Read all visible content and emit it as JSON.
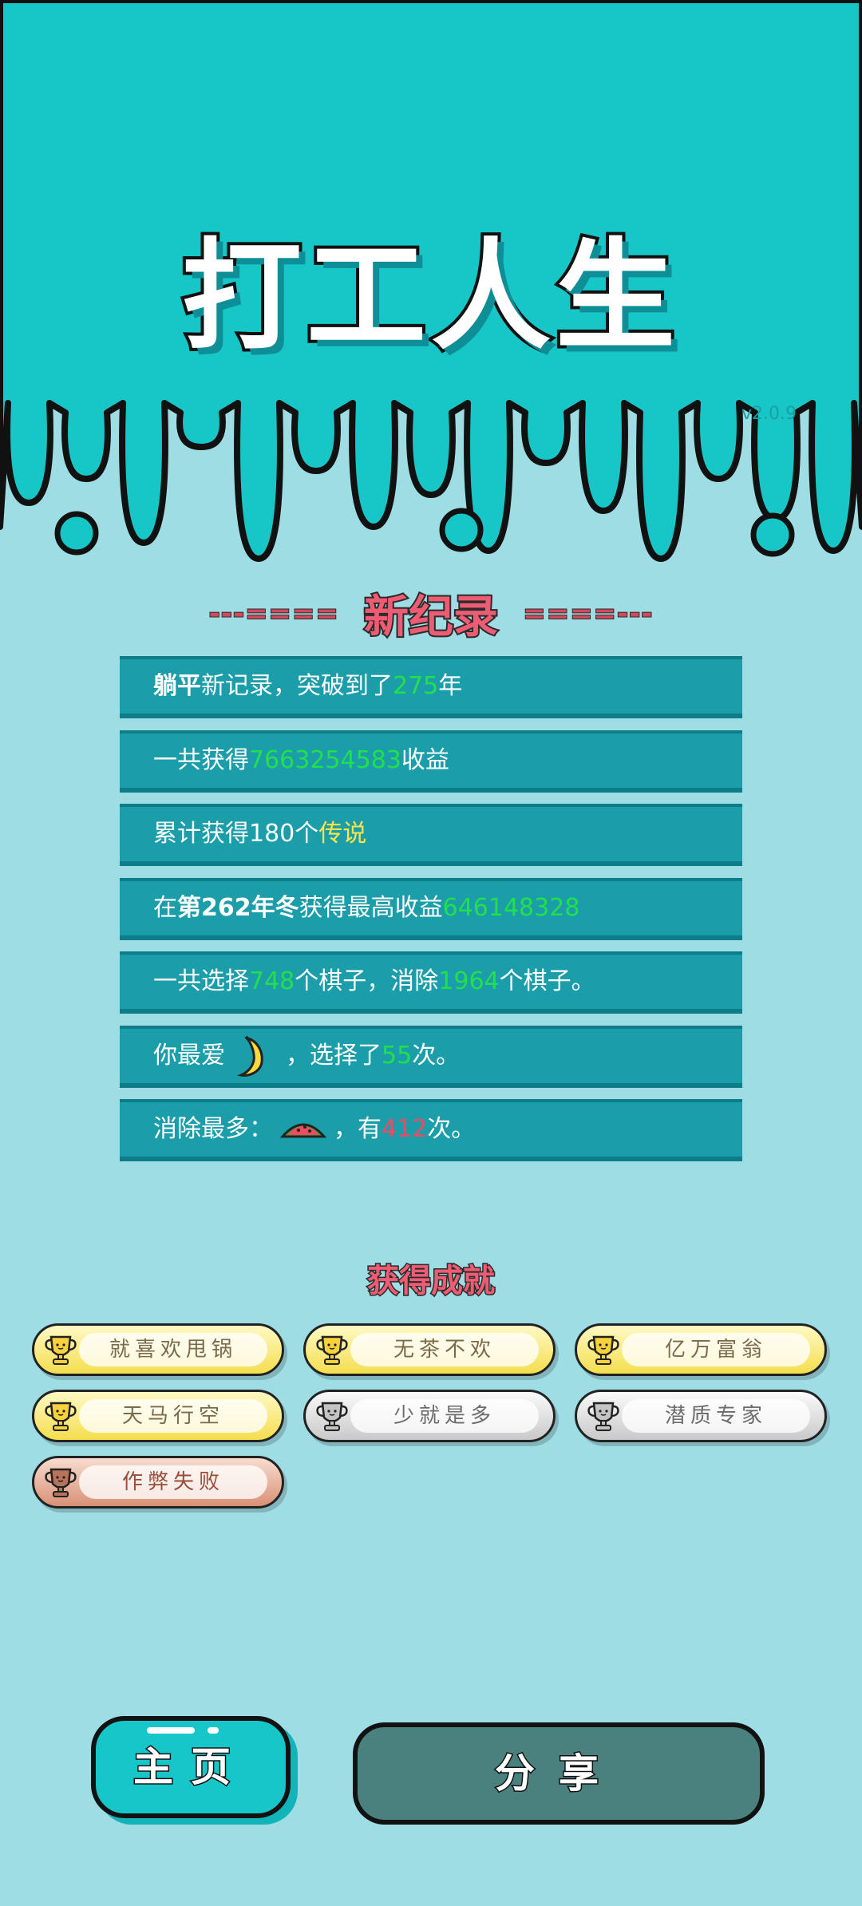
{
  "game": {
    "title": "打工人生",
    "version": "v2.0.9"
  },
  "record_section": {
    "title": "新纪录",
    "dashes_left": "---====",
    "dashes_right": "====---"
  },
  "stats": [
    {
      "parts": [
        {
          "text": "躺平",
          "style": "bold"
        },
        {
          "text": "新记录，突破到了"
        },
        {
          "text": "275",
          "style": "green"
        },
        {
          "text": "年"
        }
      ]
    },
    {
      "parts": [
        {
          "text": "一共获得"
        },
        {
          "text": "7663254583",
          "style": "green"
        },
        {
          "text": "收益"
        }
      ]
    },
    {
      "parts": [
        {
          "text": "累计获得180个"
        },
        {
          "text": "传说",
          "style": "yellow"
        }
      ]
    },
    {
      "parts": [
        {
          "text": "在"
        },
        {
          "text": "第262年冬",
          "style": "bold"
        },
        {
          "text": "获得最高收益"
        },
        {
          "text": "646148328",
          "style": "green"
        }
      ]
    },
    {
      "parts": [
        {
          "text": "一共选择"
        },
        {
          "text": "748",
          "style": "green"
        },
        {
          "text": "个棋子，消除"
        },
        {
          "text": "1964",
          "style": "green"
        },
        {
          "text": "个棋子。"
        }
      ]
    },
    {
      "parts": [
        {
          "text": "你最爱"
        },
        {
          "emoji": "banana-icon"
        },
        {
          "text": "，选择了"
        },
        {
          "text": "55",
          "style": "green"
        },
        {
          "text": "次。"
        }
      ]
    },
    {
      "parts": [
        {
          "text": "消除最多："
        },
        {
          "emoji": "watermelon-icon"
        },
        {
          "text": "，有"
        },
        {
          "text": "412",
          "style": "red"
        },
        {
          "text": "次。"
        }
      ]
    }
  ],
  "achievements": {
    "heading": "获得成就",
    "items": [
      {
        "label": "就喜欢甩锅",
        "tier": "gold"
      },
      {
        "label": "无茶不欢",
        "tier": "gold"
      },
      {
        "label": "亿万富翁",
        "tier": "gold"
      },
      {
        "label": "天马行空",
        "tier": "gold"
      },
      {
        "label": "少就是多",
        "tier": "silver"
      },
      {
        "label": "潜质专家",
        "tier": "silver"
      },
      {
        "label": "作弊失败",
        "tier": "bronze"
      }
    ]
  },
  "buttons": {
    "home": "主页",
    "share": "分享"
  },
  "colors": {
    "header": "#17c7c8",
    "background": "#9fdde4",
    "stat_row": "#1b9eaa",
    "highlight_green": "#22e04a",
    "highlight_yellow": "#ffe44c",
    "highlight_red": "#ef4b5f",
    "share_button": "#4a807d"
  }
}
